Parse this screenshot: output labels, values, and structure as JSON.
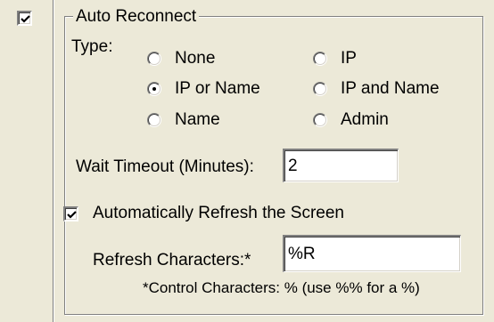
{
  "auto_reconnect": {
    "enabled": true,
    "label": "Auto Reconnect"
  },
  "type": {
    "label": "Type:",
    "options": [
      {
        "label": "None",
        "selected": false
      },
      {
        "label": "IP",
        "selected": false
      },
      {
        "label": "IP or Name",
        "selected": true
      },
      {
        "label": "IP and Name",
        "selected": false
      },
      {
        "label": "Name",
        "selected": false
      },
      {
        "label": "Admin",
        "selected": false
      }
    ]
  },
  "wait_timeout": {
    "label": "Wait Timeout (Minutes):",
    "value": "2"
  },
  "auto_refresh": {
    "checked": true,
    "label": "Automatically Refresh the Screen"
  },
  "refresh_chars": {
    "label": "Refresh Characters:*",
    "value": "%R",
    "note": "*Control Characters: % (use %% for a %)"
  }
}
